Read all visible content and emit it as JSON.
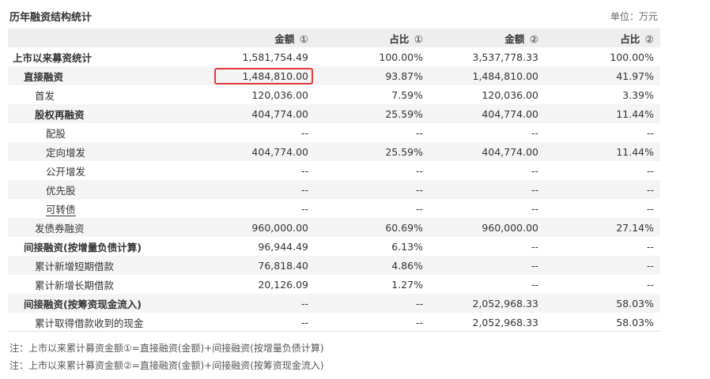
{
  "title": "历年融资结构统计",
  "unit": "单位：万元",
  "columns": [
    {
      "label": "",
      "mark": ""
    },
    {
      "label": "金额",
      "mark": "①"
    },
    {
      "label": "占比",
      "mark": "①"
    },
    {
      "label": "金额",
      "mark": "②"
    },
    {
      "label": "占比",
      "mark": "②"
    }
  ],
  "rows": [
    {
      "label": "上市以来募资统计",
      "v1": "1,581,754.49",
      "p1": "100.00%",
      "v2": "3,537,778.33",
      "p2": "100.00%"
    },
    {
      "label": "直接融资",
      "v1": "1,484,810.00",
      "p1": "93.87%",
      "v2": "1,484,810.00",
      "p2": "41.97%"
    },
    {
      "label": "首发",
      "v1": "120,036.00",
      "p1": "7.59%",
      "v2": "120,036.00",
      "p2": "3.39%"
    },
    {
      "label": "股权再融资",
      "v1": "404,774.00",
      "p1": "25.59%",
      "v2": "404,774.00",
      "p2": "11.44%"
    },
    {
      "label": "配股",
      "v1": "--",
      "p1": "--",
      "v2": "--",
      "p2": "--"
    },
    {
      "label": "定向增发",
      "v1": "404,774.00",
      "p1": "25.59%",
      "v2": "404,774.00",
      "p2": "11.44%"
    },
    {
      "label": "公开增发",
      "v1": "--",
      "p1": "--",
      "v2": "--",
      "p2": "--"
    },
    {
      "label": "优先股",
      "v1": "--",
      "p1": "--",
      "v2": "--",
      "p2": "--"
    },
    {
      "label": "可转债",
      "v1": "--",
      "p1": "--",
      "v2": "--",
      "p2": "--"
    },
    {
      "label": "发债券融资",
      "v1": "960,000.00",
      "p1": "60.69%",
      "v2": "960,000.00",
      "p2": "27.14%"
    },
    {
      "label": "间接融资(按增量负债计算)",
      "v1": "96,944.49",
      "p1": "6.13%",
      "v2": "--",
      "p2": "--"
    },
    {
      "label": "累计新增短期借款",
      "v1": "76,818.40",
      "p1": "4.86%",
      "v2": "--",
      "p2": "--"
    },
    {
      "label": "累计新增长期借款",
      "v1": "20,126.09",
      "p1": "1.27%",
      "v2": "--",
      "p2": "--"
    },
    {
      "label": "间接融资(按筹资现金流入)",
      "v1": "--",
      "p1": "--",
      "v2": "2,052,968.33",
      "p2": "58.03%"
    },
    {
      "label": "累计取得借款收到的现金",
      "v1": "--",
      "p1": "--",
      "v2": "2,052,968.33",
      "p2": "58.03%"
    }
  ],
  "notes": [
    "注：上市以来累计募资金额①=直接融资(金额)+间接融资(按增量负债计算)",
    "注：上市以来累计募资金额②=直接融资(金额)+间接融资(按筹资现金流入)"
  ],
  "colors": {
    "highlight_border": "#e23b3b",
    "header_bg": "#eeeeee",
    "stripe_bg": "#f4f4f4"
  }
}
